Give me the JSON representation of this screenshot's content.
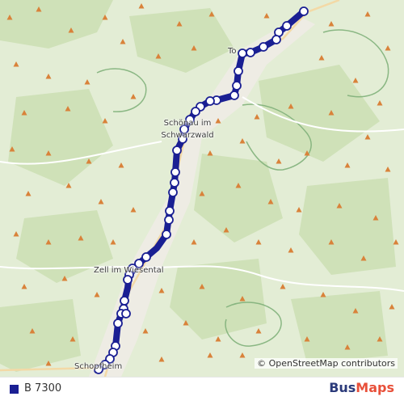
{
  "map": {
    "places": {
      "todtnau": "To",
      "schoenau": "Schönau im Schwarzwald",
      "zell": "Zell im Wiesental",
      "schopfheim": "Schopfheim"
    },
    "attribution": "© OpenStreetMap contributors",
    "route_color": "#1a1f93",
    "stop_color": "#ffffff"
  },
  "legend": {
    "route_label": "B 7300",
    "route_color": "#1a1f93"
  },
  "brand": {
    "part1": "Bus",
    "part2": "Maps",
    "color1": "#2b3a7a",
    "color2": "#e8503a"
  }
}
